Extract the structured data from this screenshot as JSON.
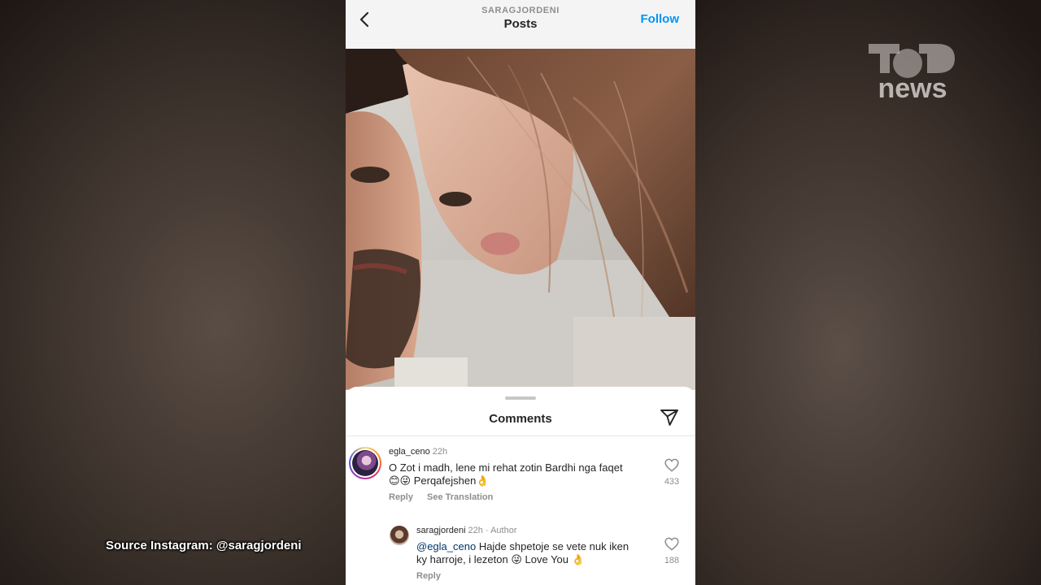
{
  "header": {
    "username": "SARAGJORDENI",
    "title": "Posts",
    "follow_label": "Follow"
  },
  "comments_sheet": {
    "title": "Comments",
    "comments": [
      {
        "username": "egla_ceno",
        "time": "22h",
        "text": "O Zot i madh, lene mi rehat zotin Bardhi nga faqet",
        "text_line2": "😊😜 Perqafejshen👌",
        "reply_label": "Reply",
        "translation_label": "See Translation",
        "likes": "433"
      },
      {
        "username": "saragjordeni",
        "time": "22h",
        "author_label": "· Author",
        "mention": "@egla_ceno",
        "text": " Hajde shpetoje se vete nuk iken",
        "text_line2": "ky harroje, i lezeton 😜 Love You 👌",
        "reply_label": "Reply",
        "likes": "188"
      }
    ]
  },
  "overlay": {
    "source": "Source Instagram: @saragjordeni",
    "logo_text": "news"
  },
  "colors": {
    "accent": "#0095f6",
    "text": "#262626",
    "muted": "#8e8e8e"
  }
}
